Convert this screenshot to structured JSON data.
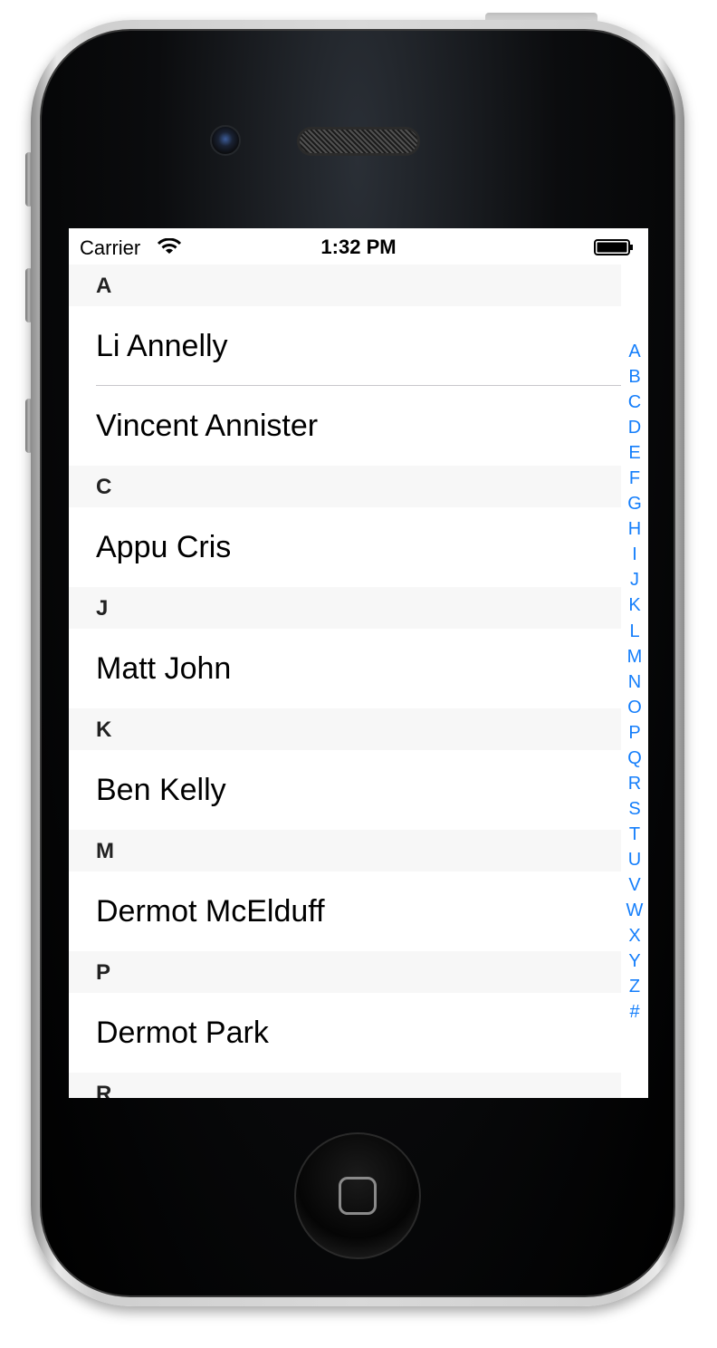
{
  "status_bar": {
    "carrier": "Carrier",
    "time": "1:32 PM"
  },
  "sections": [
    {
      "title": "A",
      "rows": [
        "Li Annelly",
        "Vincent Annister"
      ]
    },
    {
      "title": "C",
      "rows": [
        "Appu Cris"
      ]
    },
    {
      "title": "J",
      "rows": [
        "Matt John"
      ]
    },
    {
      "title": "K",
      "rows": [
        "Ben Kelly"
      ]
    },
    {
      "title": "M",
      "rows": [
        "Dermot McElduff"
      ]
    },
    {
      "title": "P",
      "rows": [
        "Dermot Park"
      ]
    },
    {
      "title": "R",
      "rows": []
    }
  ],
  "section_index": [
    "A",
    "B",
    "C",
    "D",
    "E",
    "F",
    "G",
    "H",
    "I",
    "J",
    "K",
    "L",
    "M",
    "N",
    "O",
    "P",
    "Q",
    "R",
    "S",
    "T",
    "U",
    "V",
    "W",
    "X",
    "Y",
    "Z",
    "#"
  ],
  "colors": {
    "index_tint": "#147efb",
    "section_header_bg": "#f7f7f7",
    "separator": "#c8c7cc"
  }
}
